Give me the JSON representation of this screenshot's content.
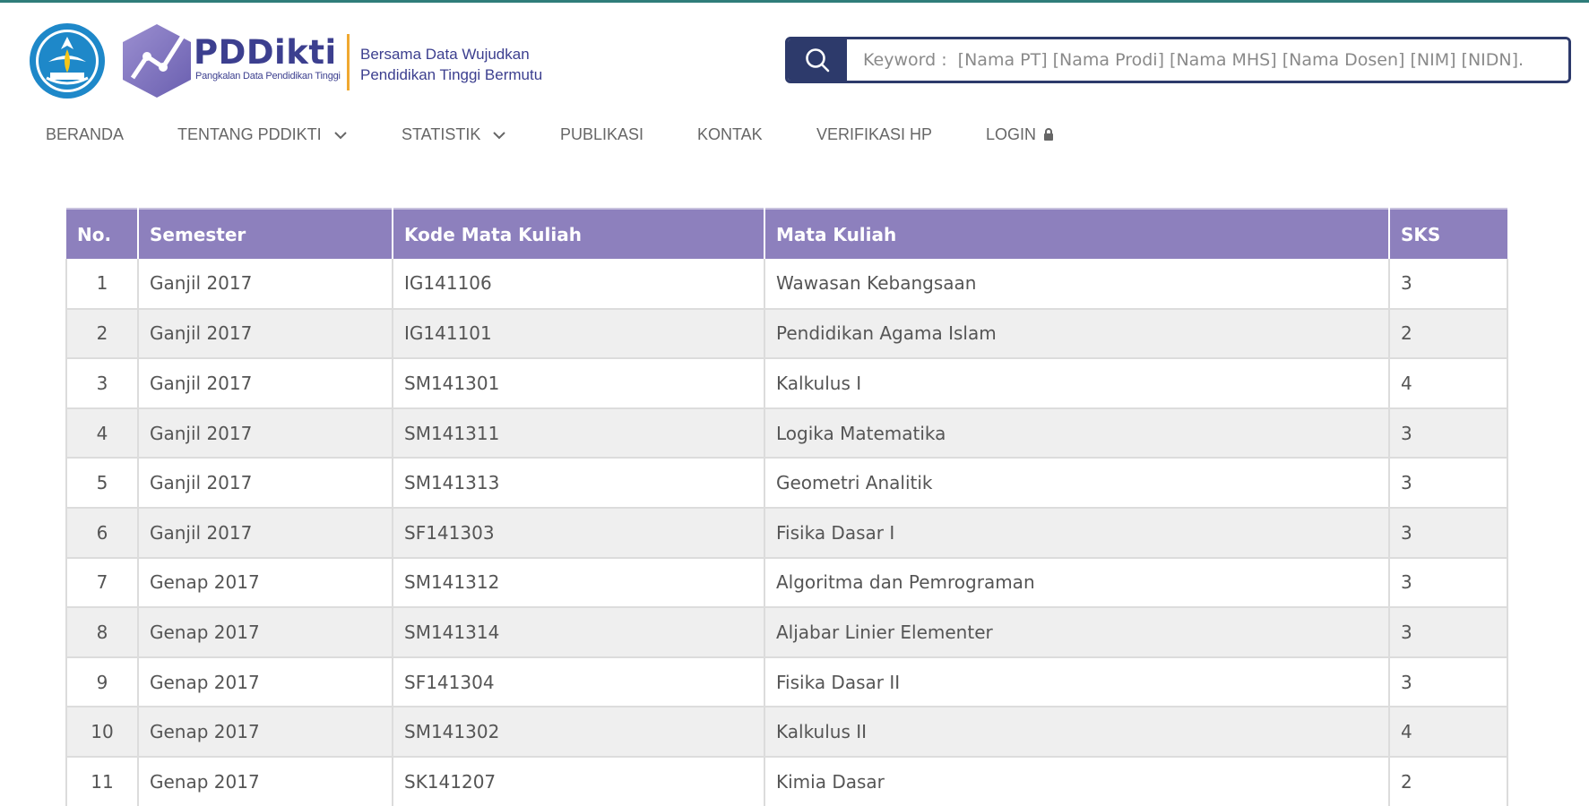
{
  "header": {
    "brand_name": "PDDikti",
    "brand_sub": "Pangkalan Data Pendidikan Tinggi",
    "tagline_line1": "Bersama Data Wujudkan",
    "tagline_line2": "Pendidikan Tinggi Bermutu",
    "logo_motto": "TUT WURI HANDAYANI"
  },
  "search": {
    "placeholder": "Keyword :  [Nama PT] [Nama Prodi] [Nama MHS] [Nama Dosen] [NIM] [NIDN].",
    "value": ""
  },
  "nav": {
    "items": [
      {
        "label": "BERANDA"
      },
      {
        "label": "TENTANG PDDIKTI"
      },
      {
        "label": "STATISTIK"
      },
      {
        "label": "PUBLIKASI"
      },
      {
        "label": "KONTAK"
      },
      {
        "label": "VERIFIKASI HP"
      },
      {
        "label": "LOGIN"
      }
    ]
  },
  "table": {
    "columns": [
      "No.",
      "Semester",
      "Kode Mata Kuliah",
      "Mata Kuliah",
      "SKS"
    ],
    "rows": [
      [
        "1",
        "Ganjil 2017",
        "IG141106",
        "Wawasan Kebangsaan",
        "3"
      ],
      [
        "2",
        "Ganjil 2017",
        "IG141101",
        "Pendidikan Agama Islam",
        "2"
      ],
      [
        "3",
        "Ganjil 2017",
        "SM141301",
        "Kalkulus I",
        "4"
      ],
      [
        "4",
        "Ganjil 2017",
        "SM141311",
        "Logika Matematika",
        "3"
      ],
      [
        "5",
        "Ganjil 2017",
        "SM141313",
        "Geometri Analitik",
        "3"
      ],
      [
        "6",
        "Ganjil 2017",
        "SF141303",
        "Fisika Dasar I",
        "3"
      ],
      [
        "7",
        "Genap 2017",
        "SM141312",
        "Algoritma dan Pemrograman",
        "3"
      ],
      [
        "8",
        "Genap 2017",
        "SM141314",
        "Aljabar Linier Elementer",
        "3"
      ],
      [
        "9",
        "Genap 2017",
        "SF141304",
        "Fisika Dasar II",
        "3"
      ],
      [
        "10",
        "Genap 2017",
        "SM141302",
        "Kalkulus II",
        "4"
      ],
      [
        "11",
        "Genap 2017",
        "SK141207",
        "Kimia Dasar",
        "2"
      ]
    ]
  },
  "colors": {
    "header_accent": "#2d3a6b",
    "table_header_bg": "#8d80bd",
    "brand_text": "#3c3f8f",
    "divider": "#f0a830"
  }
}
